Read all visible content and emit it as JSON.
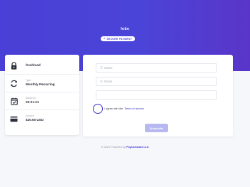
{
  "header": {
    "logo_text": "fobe",
    "secure_badge": "SECURE PAYMENT",
    "secure_icon": "lock-icon",
    "hero_color": "#4a3fd6"
  },
  "summary": {
    "product": {
      "icon": "lock-icon",
      "value": "freshload"
    },
    "type": {
      "icon": "refresh-icon",
      "label": "Type",
      "value": "Monthly Recurring"
    },
    "starts_on": {
      "icon": "calendar-check-icon",
      "label": "Starts On",
      "value": "09-01-21"
    },
    "amount": {
      "icon": "credit-card-icon",
      "label": "Amount",
      "value": "$20.00 USD"
    }
  },
  "form": {
    "name": {
      "placeholder": "Name",
      "icon": "user-icon",
      "value": ""
    },
    "email": {
      "placeholder": "Email",
      "icon": "mail-icon",
      "value": ""
    },
    "card": {
      "placeholder": "",
      "value": ""
    },
    "terms_text": "I agree with the",
    "terms_link": "Terms of service",
    "subscribe_label": "Subscribe",
    "subscribe_color": "#b7b8f2"
  },
  "footer": {
    "prefix": "© 2021 Powered by",
    "brand": "Paykickstart LLC"
  }
}
